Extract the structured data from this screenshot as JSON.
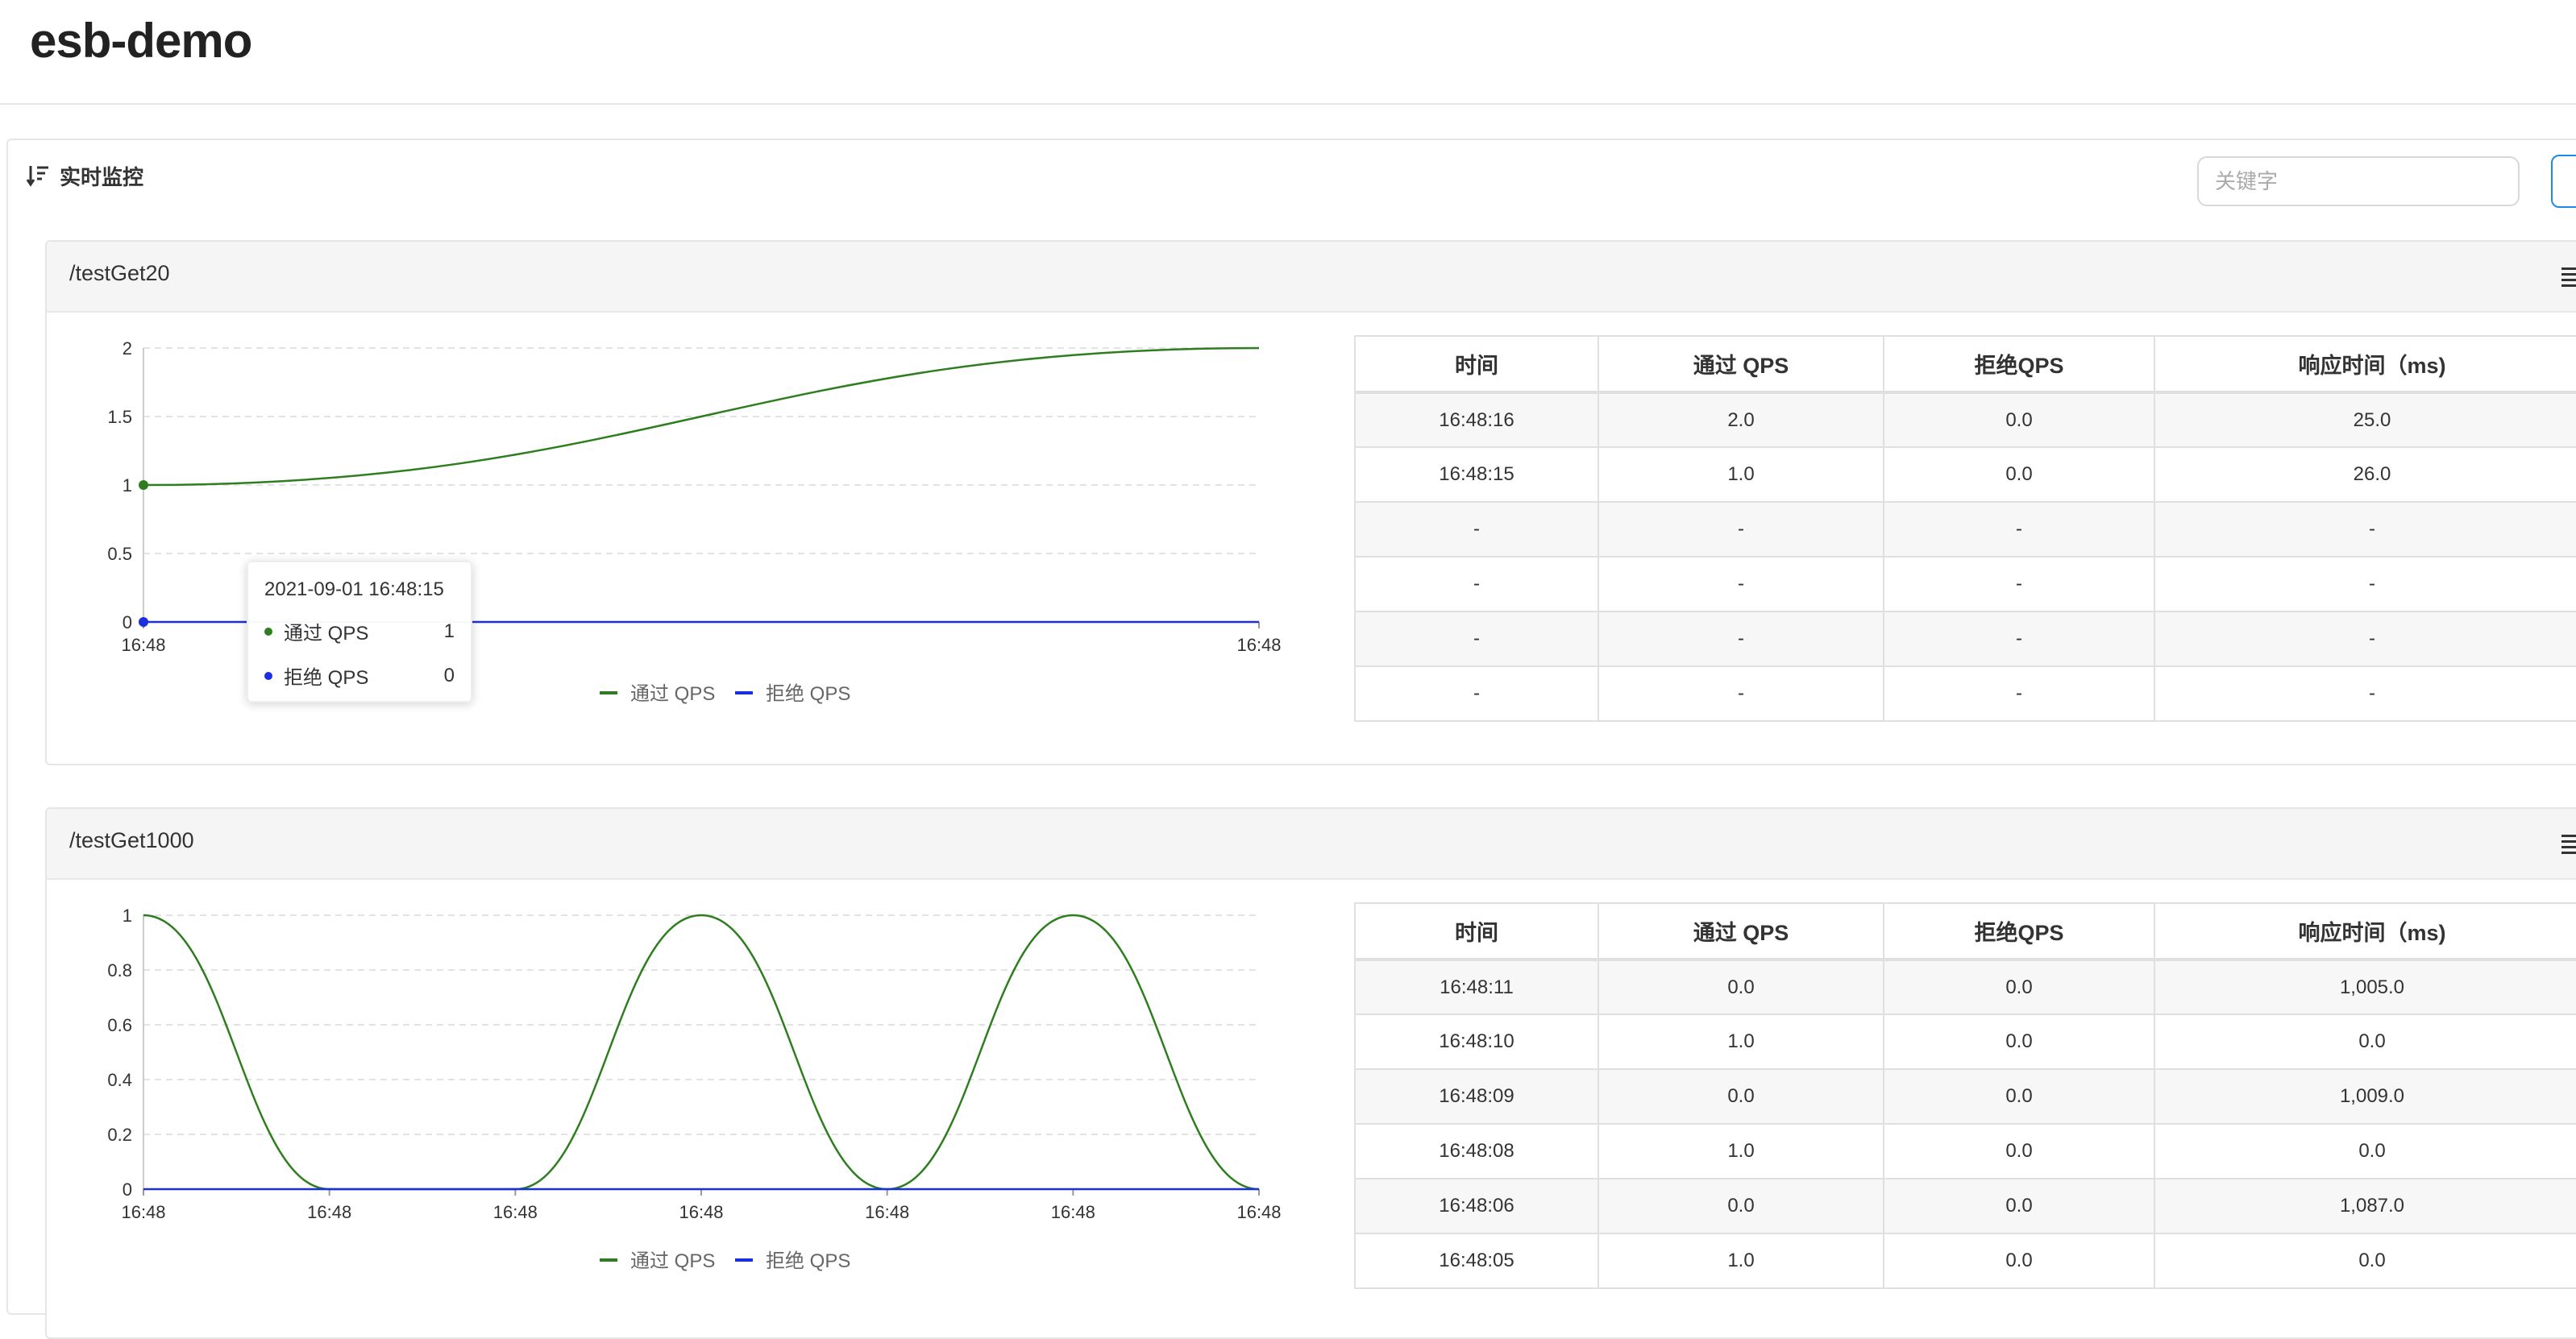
{
  "app": {
    "title": "esb-demo"
  },
  "panel": {
    "title": "实时监控",
    "search_placeholder": "关键字"
  },
  "colors": {
    "pass": "#2e7d1e",
    "block": "#1a2fe0",
    "grid": "#e3e3e3",
    "axis": "#999999"
  },
  "icons": {
    "sort": "sort-descending-icon",
    "menu": "hamburger-menu-icon"
  },
  "table_headers": [
    "时间",
    "通过 QPS",
    "拒绝QPS",
    "响应时间（ms)"
  ],
  "resources": [
    {
      "name": "/testGet20",
      "tooltip": {
        "time": "2021-09-01 16:48:15",
        "items": [
          {
            "label": "通过 QPS",
            "value": "1"
          },
          {
            "label": "拒绝 QPS",
            "value": "0"
          }
        ]
      },
      "rows": [
        [
          "16:48:16",
          "2.0",
          "0.0",
          "25.0"
        ],
        [
          "16:48:15",
          "1.0",
          "0.0",
          "26.0"
        ],
        [
          "-",
          "-",
          "-",
          "-"
        ],
        [
          "-",
          "-",
          "-",
          "-"
        ],
        [
          "-",
          "-",
          "-",
          "-"
        ],
        [
          "-",
          "-",
          "-",
          "-"
        ]
      ]
    },
    {
      "name": "/testGet1000",
      "rows": [
        [
          "16:48:11",
          "0.0",
          "0.0",
          "1,005.0"
        ],
        [
          "16:48:10",
          "1.0",
          "0.0",
          "0.0"
        ],
        [
          "16:48:09",
          "0.0",
          "0.0",
          "1,009.0"
        ],
        [
          "16:48:08",
          "1.0",
          "0.0",
          "0.0"
        ],
        [
          "16:48:06",
          "0.0",
          "0.0",
          "1,087.0"
        ],
        [
          "16:48:05",
          "1.0",
          "0.0",
          "0.0"
        ]
      ]
    }
  ],
  "chart_data": [
    {
      "type": "line",
      "x": [
        "16:48",
        "16:48"
      ],
      "ylim": [
        0,
        2
      ],
      "yticks": [
        "0",
        "0.5",
        "1",
        "1.5",
        "2"
      ],
      "series": [
        {
          "name": "通过 QPS",
          "values": [
            1,
            2
          ]
        },
        {
          "name": "拒绝 QPS",
          "values": [
            0,
            0
          ]
        }
      ],
      "legend": "bottom-center",
      "grid": true
    },
    {
      "type": "line",
      "x": [
        "16:48",
        "16:48",
        "16:48",
        "16:48",
        "16:48",
        "16:48",
        "16:48"
      ],
      "ylim": [
        0,
        1
      ],
      "yticks": [
        "0",
        "0.2",
        "0.4",
        "0.6",
        "0.8",
        "1"
      ],
      "series": [
        {
          "name": "通过 QPS",
          "values": [
            1,
            0,
            0,
            1,
            0,
            1,
            0
          ]
        },
        {
          "name": "拒绝 QPS",
          "values": [
            0,
            0,
            0,
            0,
            0,
            0,
            0
          ]
        }
      ],
      "legend": "bottom-center",
      "grid": true
    }
  ]
}
